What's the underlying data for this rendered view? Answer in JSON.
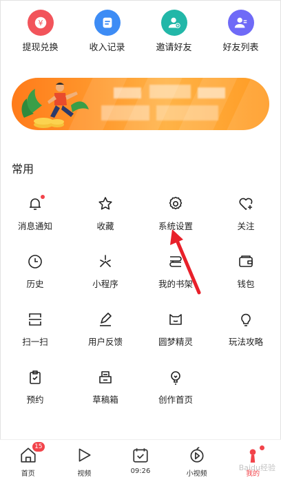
{
  "quick_actions": [
    {
      "label": "提现兑换",
      "icon": "yuan-coin-icon",
      "color": "#f2545b",
      "glyph": "¥"
    },
    {
      "label": "收入记录",
      "icon": "document-icon",
      "color": "#3d8cf5"
    },
    {
      "label": "邀请好友",
      "icon": "add-user-icon",
      "color": "#22b7a8"
    },
    {
      "label": "好友列表",
      "icon": "user-list-icon",
      "color": "#6f6af7"
    }
  ],
  "section": {
    "title": "常用"
  },
  "grid": [
    [
      {
        "label": "消息通知",
        "icon": "bell-icon",
        "dot": true
      },
      {
        "label": "收藏",
        "icon": "star-icon"
      },
      {
        "label": "系统设置",
        "icon": "gear-icon"
      },
      {
        "label": "关注",
        "icon": "heart-plus-icon"
      }
    ],
    [
      {
        "label": "历史",
        "icon": "clock-icon"
      },
      {
        "label": "小程序",
        "icon": "sparkle-icon"
      },
      {
        "label": "我的书架",
        "icon": "bookshelf-icon"
      },
      {
        "label": "钱包",
        "icon": "wallet-icon"
      }
    ],
    [
      {
        "label": "扫一扫",
        "icon": "scan-icon"
      },
      {
        "label": "用户反馈",
        "icon": "edit-icon"
      },
      {
        "label": "圆梦精灵",
        "icon": "cat-icon"
      },
      {
        "label": "玩法攻略",
        "icon": "bulb-icon"
      }
    ],
    [
      {
        "label": "预约",
        "icon": "clipboard-icon"
      },
      {
        "label": "草稿箱",
        "icon": "drafts-icon"
      },
      {
        "label": "创作首页",
        "icon": "lightbulb-icon"
      }
    ]
  ],
  "bottom_nav": [
    {
      "label": "首页",
      "icon": "home-icon",
      "badge": "15"
    },
    {
      "label": "视频",
      "icon": "play-icon"
    },
    {
      "label": "09:26",
      "icon": "calendar-check-icon"
    },
    {
      "label": "小视频",
      "icon": "small-video-icon"
    },
    {
      "label": "我的",
      "icon": "me-icon",
      "active": true,
      "dot": true
    }
  ],
  "watermark": "Baidu经验",
  "colors": {
    "accent": "#f2434a",
    "banner": "#ff8a1f",
    "arrow": "#e8202a"
  }
}
